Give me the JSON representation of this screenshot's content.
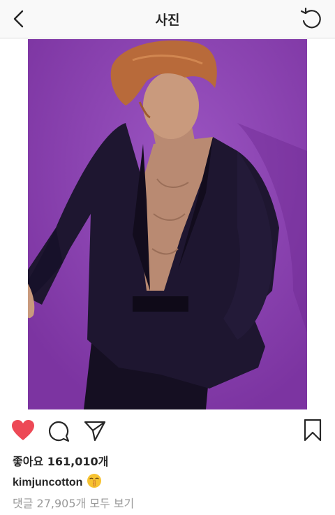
{
  "header": {
    "title": "사진",
    "back_icon": "chevron-left-icon",
    "refresh_icon": "refresh-icon"
  },
  "post": {
    "image_colors": {
      "background": "#8a3fb0",
      "suit": "#1e1630",
      "hair": "#b86a3a",
      "skin": "#c99a7d"
    },
    "actions": {
      "like_icon": "heart-filled-icon",
      "like_color": "#ed4956",
      "comment_icon": "speech-bubble-icon",
      "share_icon": "paper-plane-icon",
      "save_icon": "bookmark-icon"
    },
    "likes_text": "좋아요 161,010개",
    "caption": {
      "username": "kimjuncotton",
      "emoji": "🤫"
    },
    "view_comments": "댓글 27,905개 모두 보기"
  }
}
